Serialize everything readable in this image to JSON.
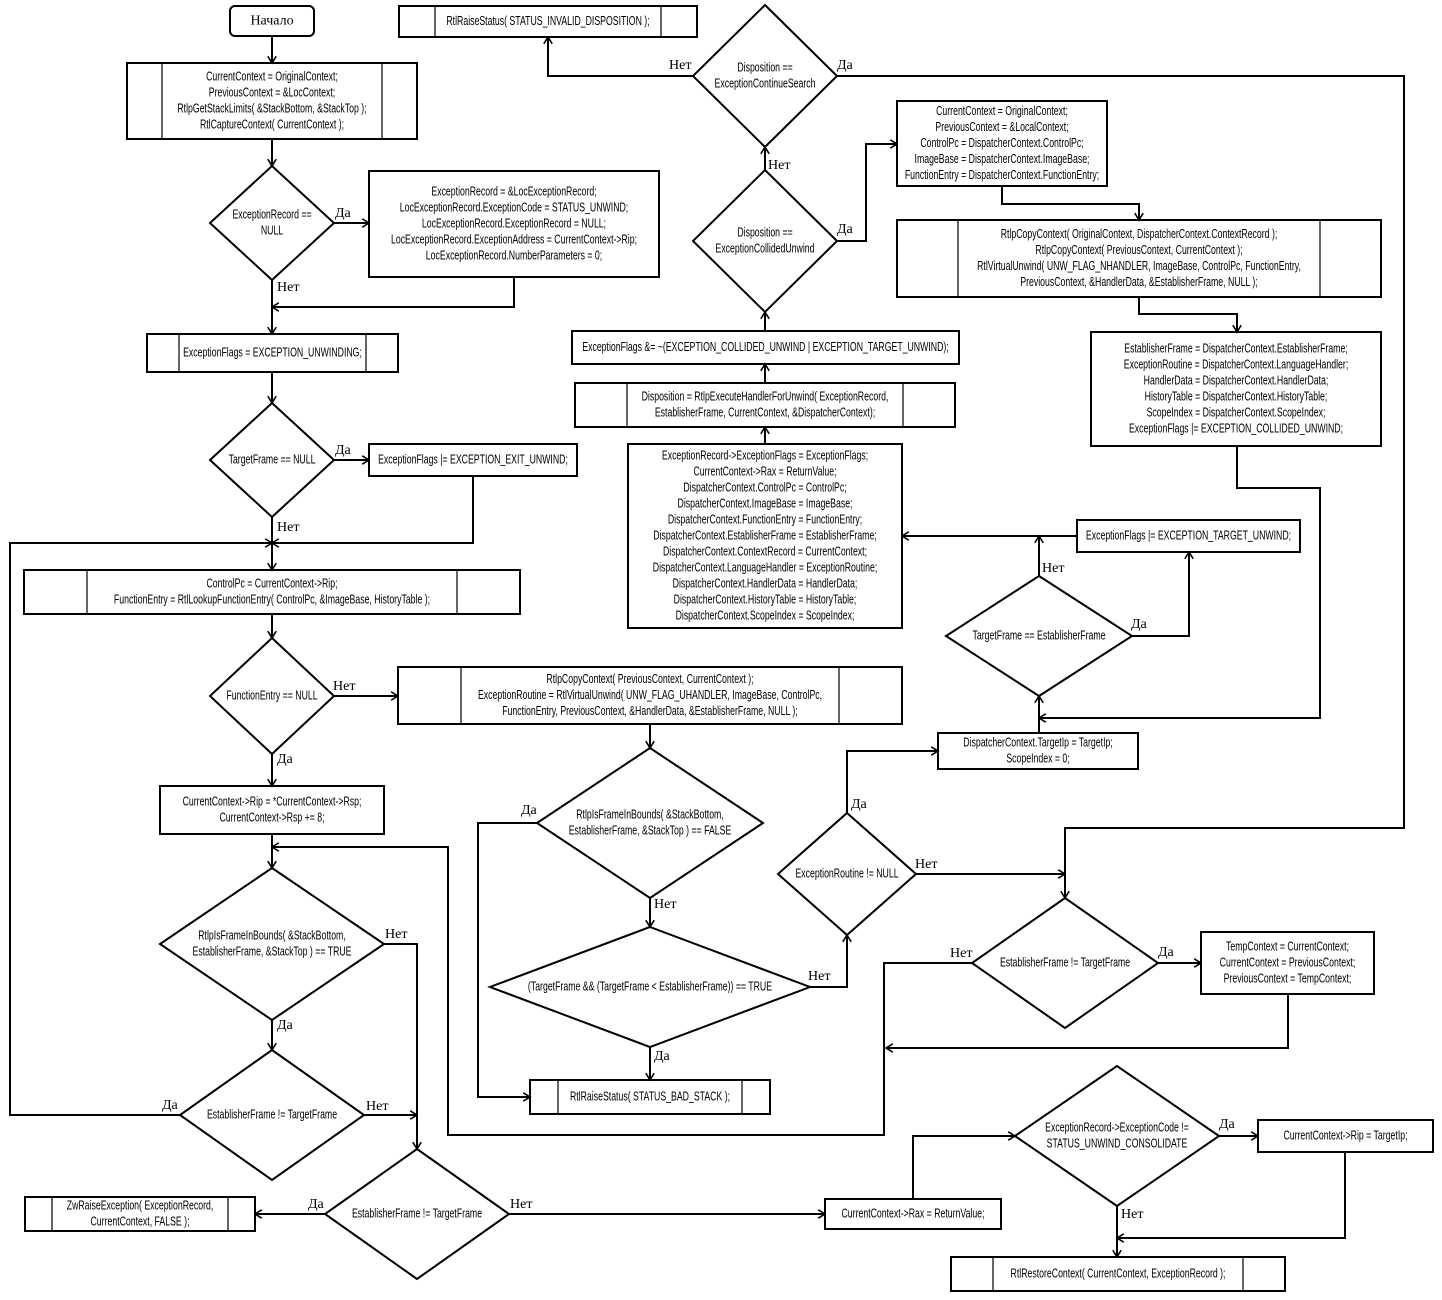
{
  "diagram": {
    "nodes": {
      "start": {
        "type": "terminal",
        "lines": [
          "Начало"
        ]
      },
      "p1": {
        "type": "subroutine",
        "lines": [
          "CurrentContext = OriginalContext;",
          "PreviousContext = &LocContext;",
          "RtlpGetStackLimits( &StackBottom, &StackTop );",
          "RtlCaptureContext( CurrentContext );"
        ]
      },
      "d1": {
        "type": "decision",
        "lines": [
          "ExceptionRecord ==",
          "NULL"
        ]
      },
      "b1": {
        "type": "process",
        "lines": [
          "ExceptionRecord = &LocExceptionRecord;",
          "LocExceptionRecord.ExceptionCode = STATUS_UNWIND;",
          "LocExceptionRecord.ExceptionRecord = NULL;",
          "LocExceptionRecord.ExceptionAddress = CurrentContext->Rip;",
          "LocExceptionRecord.NumberParameters = 0;"
        ]
      },
      "p2": {
        "type": "subroutine",
        "lines": [
          "ExceptionFlags = EXCEPTION_UNWINDING;"
        ]
      },
      "d2": {
        "type": "decision",
        "lines": [
          "TargetFrame == NULL"
        ]
      },
      "b2": {
        "type": "process",
        "lines": [
          "ExceptionFlags |= EXCEPTION_EXIT_UNWIND;"
        ]
      },
      "p3": {
        "type": "subroutine",
        "lines": [
          "ControlPc = CurrentContext->Rip;",
          "FunctionEntry = RtlLookupFunctionEntry( ControlPc, &ImageBase, HistoryTable );"
        ]
      },
      "d3": {
        "type": "decision",
        "lines": [
          "FunctionEntry == NULL"
        ]
      },
      "p4": {
        "type": "subroutine",
        "lines": [
          "RtlpCopyContext( PreviousContext, CurrentContext );",
          "ExceptionRoutine = RtlVirtualUnwind( UNW_FLAG_UHANDLER, ImageBase, ControlPc,",
          "FunctionEntry, PreviousContext, &HandlerData, &EstablisherFrame, NULL );"
        ]
      },
      "b3": {
        "type": "process",
        "lines": [
          "CurrentContext->Rip = *CurrentContext->Rsp;",
          "CurrentContext->Rsp += 8;"
        ]
      },
      "d4": {
        "type": "decision",
        "lines": [
          "RtlpIsFrameInBounds( &StackBottom,",
          "EstablisherFrame, &StackTop ) == TRUE"
        ]
      },
      "d5": {
        "type": "decision",
        "lines": [
          "EstablisherFrame != TargetFrame"
        ]
      },
      "d6": {
        "type": "decision",
        "lines": [
          "EstablisherFrame != TargetFrame"
        ]
      },
      "p5": {
        "type": "subroutine",
        "lines": [
          "ZwRaiseException( ExceptionRecord,",
          "CurrentContext, FALSE );"
        ]
      },
      "b4": {
        "type": "process",
        "lines": [
          "CurrentContext->Rax = ReturnValue;"
        ]
      },
      "d7": {
        "type": "decision",
        "lines": [
          "RtlpIsFrameInBounds( &StackBottom,",
          "EstablisherFrame, &StackTop ) == FALSE"
        ]
      },
      "d8": {
        "type": "decision",
        "lines": [
          "(TargetFrame && (TargetFrame < EstablisherFrame)) == TRUE"
        ]
      },
      "p6": {
        "type": "subroutine",
        "lines": [
          "RtlRaiseStatus( STATUS_BAD_STACK );"
        ]
      },
      "d9": {
        "type": "decision",
        "lines": [
          "ExceptionRoutine != NULL"
        ]
      },
      "b5": {
        "type": "process",
        "lines": [
          "DispatcherContext.TargetIp = TargetIp;",
          "ScopeIndex = 0;"
        ]
      },
      "d10": {
        "type": "decision",
        "lines": [
          "TargetFrame == EstablisherFrame"
        ]
      },
      "b6": {
        "type": "process",
        "lines": [
          "ExceptionFlags |= EXCEPTION_TARGET_UNWIND;"
        ]
      },
      "b7": {
        "type": "process",
        "lines": [
          "ExceptionRecord->ExceptionFlags = ExceptionFlags;",
          "CurrentContext->Rax = ReturnValue;",
          "DispatcherContext.ControlPc = ControlPc;",
          "DispatcherContext.ImageBase = ImageBase;",
          "DispatcherContext.FunctionEntry = FunctionEntry;",
          "DispatcherContext.EstablisherFrame = EstablisherFrame;",
          "DispatcherContext.ContextRecord = CurrentContext;",
          "DispatcherContext.LanguageHandler = ExceptionRoutine;",
          "DispatcherContext.HandlerData = HandlerData;",
          "DispatcherContext.HistoryTable = HistoryTable;",
          "DispatcherContext.ScopeIndex = ScopeIndex;"
        ]
      },
      "p7": {
        "type": "subroutine",
        "lines": [
          "Disposition = RtlpExecuteHandlerForUnwind( ExceptionRecord,",
          "EstablisherFrame, CurrentContext, &DispatcherContext);"
        ]
      },
      "b8": {
        "type": "process",
        "lines": [
          "ExceptionFlags &= ~(EXCEPTION_COLLIDED_UNWIND | EXCEPTION_TARGET_UNWIND);"
        ]
      },
      "d11": {
        "type": "decision",
        "lines": [
          "Disposition ==",
          "ExceptionCollidedUnwind"
        ]
      },
      "d12": {
        "type": "decision",
        "lines": [
          "Disposition ==",
          "ExceptionContinueSearch"
        ]
      },
      "p8": {
        "type": "subroutine",
        "lines": [
          "RtlRaiseStatus( STATUS_INVALID_DISPOSITION );"
        ]
      },
      "b9": {
        "type": "process",
        "lines": [
          "CurrentContext = OriginalContext;",
          "PreviousContext = &LocalContext;",
          "ControlPc = DispatcherContext.ControlPc;",
          "ImageBase = DispatcherContext.ImageBase;",
          "FunctionEntry = DispatcherContext.FunctionEntry;"
        ]
      },
      "p9": {
        "type": "subroutine",
        "lines": [
          "RtlpCopyContext( OriginalContext, DispatcherContext.ContextRecord );",
          "RtlpCopyContext( PreviousContext, CurrentContext );",
          "RtlVirtualUnwind( UNW_FLAG_NHANDLER, ImageBase, ControlPc, FunctionEntry,",
          "PreviousContext, &HandlerData, &EstablisherFrame, NULL );"
        ]
      },
      "b10": {
        "type": "process",
        "lines": [
          "EstablisherFrame = DispatcherContext.EstablisherFrame;",
          "ExceptionRoutine = DispatcherContext.LanguageHandler;",
          "HandlerData = DispatcherContext.HandlerData;",
          "HistoryTable = DispatcherContext.HistoryTable;",
          "ScopeIndex = DispatcherContext.ScopeIndex;",
          "ExceptionFlags |= EXCEPTION_COLLIDED_UNWIND;"
        ]
      },
      "d13": {
        "type": "decision",
        "lines": [
          "EstablisherFrame != TargetFrame"
        ]
      },
      "b11": {
        "type": "process",
        "lines": [
          "TempContext = CurrentContext;",
          "CurrentContext = PreviousContext;",
          "PreviousContext = TempContext;"
        ]
      },
      "d14": {
        "type": "decision",
        "lines": [
          "ExceptionRecord->ExceptionCode !=",
          "STATUS_UNWIND_CONSOLIDATE"
        ]
      },
      "b12": {
        "type": "process",
        "lines": [
          "CurrentContext->Rip = TargetIp;"
        ]
      },
      "p10": {
        "type": "subroutine",
        "lines": [
          "RtlRestoreContext( CurrentContext, ExceptionRecord );"
        ]
      }
    },
    "branch_labels": {
      "yes": "Да",
      "no": "Нет"
    }
  }
}
